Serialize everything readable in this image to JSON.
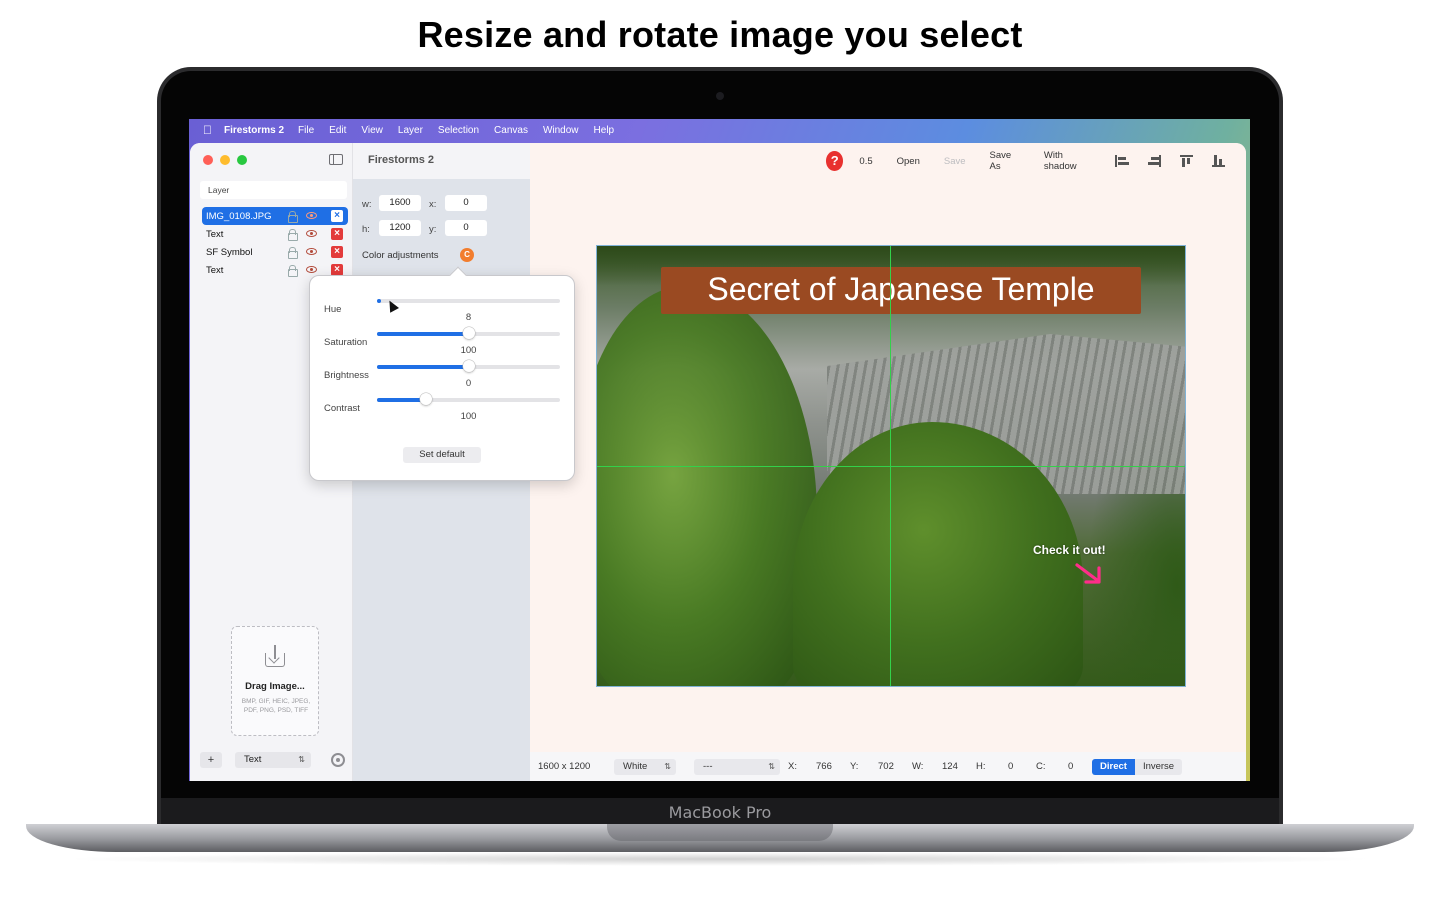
{
  "headline": "Resize and rotate image you select",
  "device_label": "MacBook Pro",
  "colors": {
    "accent": "#1f6fe5",
    "danger": "#e33b3b",
    "banner": "#9a4a22",
    "guide": "#33d14a",
    "adjust": "#f27d2e"
  },
  "menubar": {
    "apple_icon": "apple-logo-icon",
    "app_name": "Firestorms 2",
    "items": [
      "File",
      "Edit",
      "View",
      "Layer",
      "Selection",
      "Canvas",
      "Window",
      "Help"
    ]
  },
  "sidebar": {
    "layer_header": "Layer",
    "layers": [
      {
        "name": "IMG_0108.JPG",
        "selected": true
      },
      {
        "name": "Text",
        "selected": false
      },
      {
        "name": "SF Symbol",
        "selected": false
      },
      {
        "name": "Text",
        "selected": false
      }
    ],
    "dropzone": {
      "title": "Drag Image...",
      "formats": "BMP, GIF, HEIC, JPEG, PDF, PNG, PSD, TIFF"
    },
    "footer": {
      "add_label": "+",
      "type_value": "Text"
    }
  },
  "inspector": {
    "title": "Firestorms 2",
    "w_label": "w:",
    "w_value": "1600",
    "x_label": "x:",
    "x_value": "0",
    "h_label": "h:",
    "h_value": "1200",
    "y_label": "y:",
    "y_value": "0",
    "color_adjustments_label": "Color adjustments",
    "color_adjustments_badge": "C"
  },
  "popover": {
    "sliders": [
      {
        "label": "Hue",
        "value": "8",
        "fraction": 0.02
      },
      {
        "label": "Saturation",
        "value": "100",
        "fraction": 0.5
      },
      {
        "label": "Brightness",
        "value": "0",
        "fraction": 0.5
      },
      {
        "label": "Contrast",
        "value": "100",
        "fraction": 0.27
      }
    ],
    "set_default_label": "Set default"
  },
  "toolbar": {
    "help_label": "?",
    "zoom": "0.5",
    "open": "Open",
    "save": "Save",
    "save_as": "Save As",
    "with_shadow": "With shadow"
  },
  "canvas": {
    "banner_text": "Secret of Japanese Temple",
    "callout_text": "Check it out!"
  },
  "statusbar": {
    "size": "1600 x 1200",
    "background": "White",
    "preset": "---",
    "x_label": "X:",
    "x_value": "766",
    "y_label": "Y:",
    "y_value": "702",
    "w_label": "W:",
    "w_value": "124",
    "h_label": "H:",
    "h_value": "0",
    "c_label": "C:",
    "c_value": "0",
    "mode_direct": "Direct",
    "mode_inverse": "Inverse"
  }
}
